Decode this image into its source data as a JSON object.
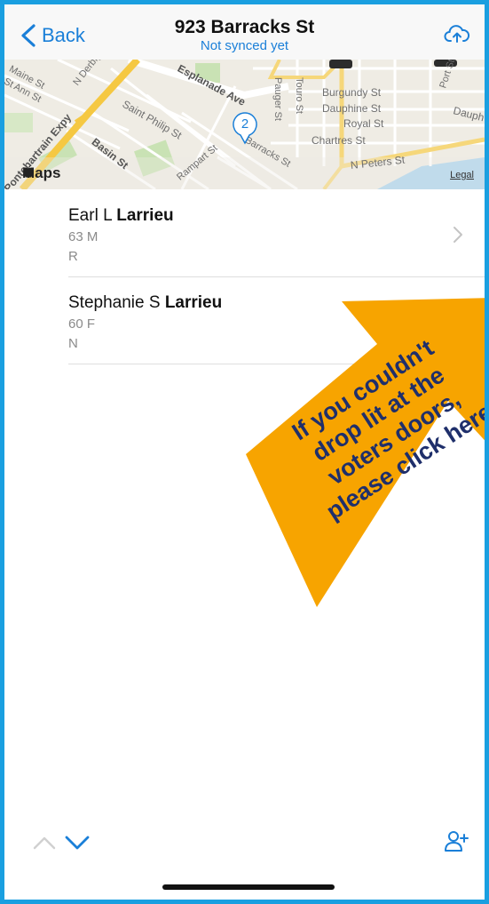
{
  "nav": {
    "back_label": "Back",
    "title": "923 Barracks St",
    "subtitle": "Not synced yet",
    "accent_color": "#1a7fd8"
  },
  "map": {
    "brand": "Maps",
    "legal": "Legal",
    "cluster_count": "2",
    "labels": {
      "st_ann": "St Ann St",
      "maine": "Maine St",
      "n_derbigny": "N Derbigny",
      "esplanade": "Esplanade Ave",
      "saint_philip": "Saint Philip St",
      "basin": "Basin St",
      "pontchartrain": "Pontchartrain Expy",
      "rampart": "Rampart St",
      "touro": "Touro St",
      "pauger": "Pauger St",
      "burgundy": "Burgundy St",
      "dauphine": "Dauphine St",
      "royal": "Royal St",
      "chartres": "Chartres St",
      "n_peters": "N Peters St",
      "barracks": "Barracks St",
      "port": "Port St",
      "dauphine_right": "Dauph"
    }
  },
  "voters": [
    {
      "first": "Earl L",
      "last": "Larrieu",
      "age_sex": "63 M",
      "party": "R"
    },
    {
      "first": "Stephanie S",
      "last": "Larrieu",
      "age_sex": "60 F",
      "party": "N"
    }
  ],
  "callout": {
    "text": "If you couldn't drop lit at the voters doors, please click here",
    "lines": [
      "If you couldn't",
      "drop lit at the",
      "voters doors,",
      "please click here"
    ],
    "color": "#f7a400",
    "text_color": "#1f2f6b"
  },
  "frame_color": "#1a9fe0"
}
